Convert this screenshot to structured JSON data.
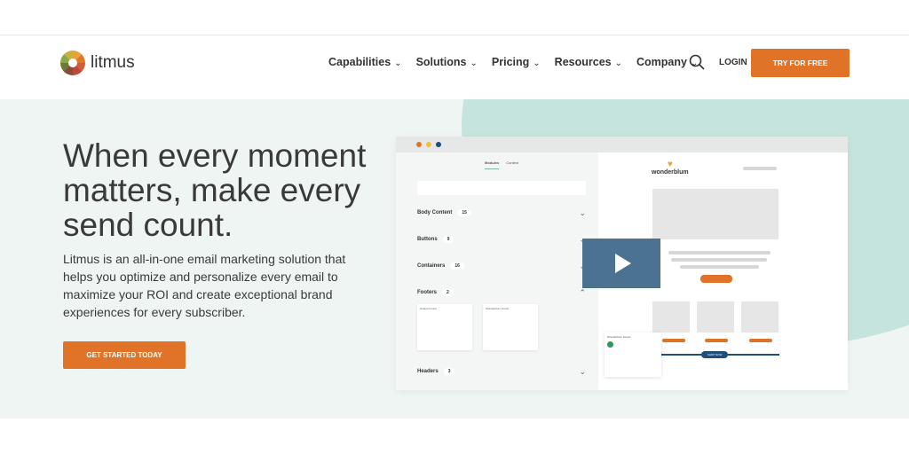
{
  "nav": {
    "brand": "litmus",
    "items": [
      {
        "label": "Capabilities"
      },
      {
        "label": "Solutions"
      },
      {
        "label": "Pricing"
      },
      {
        "label": "Resources"
      },
      {
        "label": "Company"
      }
    ],
    "login": "LOGIN",
    "cta": "TRY FOR FREE",
    "chevron": "⌄"
  },
  "hero": {
    "title": "When every moment matters, make every send count.",
    "description": "Litmus is an all-in-one email marketing solution that helps you optimize and personalize every email to maximize your ROI and create exceptional brand experiences for every subscriber.",
    "cta": "GET STARTED TODAY"
  },
  "app": {
    "tabs": [
      "Modules",
      "Content"
    ],
    "sections": [
      {
        "label": "Body Content",
        "count": "15"
      },
      {
        "label": "Buttons",
        "count": "9"
      },
      {
        "label": "Containers",
        "count": "16"
      },
      {
        "label": "Footers",
        "count": "2"
      },
      {
        "label": "Headers",
        "count": "3"
      }
    ],
    "cards": [
      "Default Footer",
      "Wonderblum Footer"
    ],
    "brand": "wonderblum",
    "drag_card": "Wonderblum Footer",
    "nav_button": "SHOP NOW"
  },
  "colors": {
    "accent": "#e07327",
    "teal": "#c5e4dd",
    "hero_bg": "#eef5f3",
    "video": "#4b7290"
  }
}
